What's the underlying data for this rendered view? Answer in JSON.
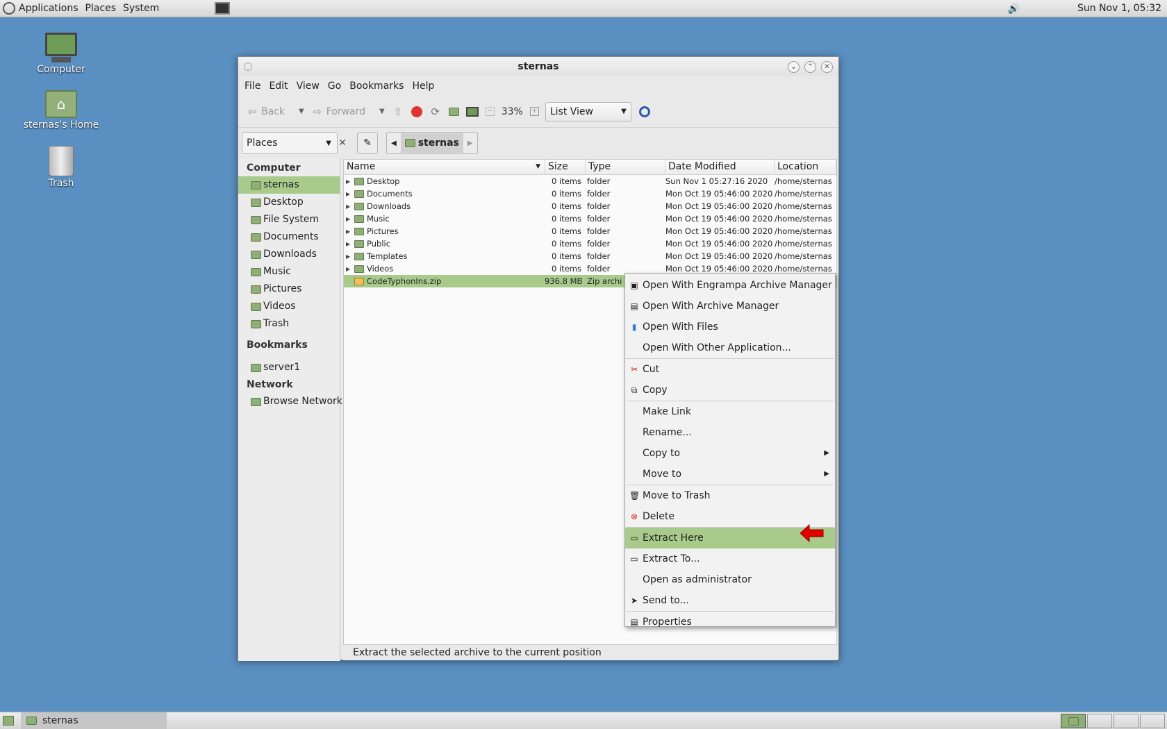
{
  "top_panel": {
    "applications": "Applications",
    "places": "Places",
    "system": "System",
    "clock": "Sun Nov  1, 05:32"
  },
  "desktop": {
    "icons": [
      {
        "label": "Computer"
      },
      {
        "label": "sternas's Home"
      },
      {
        "label": "Trash"
      }
    ]
  },
  "window": {
    "title": "sternas",
    "menu": [
      "File",
      "Edit",
      "View",
      "Go",
      "Bookmarks",
      "Help"
    ],
    "toolbar": {
      "back": "Back",
      "forward": "Forward",
      "zoom": "33%",
      "view_mode": "List View"
    },
    "location": {
      "places_label": "Places",
      "path": "sternas"
    },
    "sidebar": {
      "computer_header": "Computer",
      "computer_items": [
        "sternas",
        "Desktop",
        "File System",
        "Documents",
        "Downloads",
        "Music",
        "Pictures",
        "Videos",
        "Trash"
      ],
      "bookmarks_header": "Bookmarks",
      "bookmark_items": [
        "server1"
      ],
      "network_header": "Network",
      "network_items": [
        "Browse Network"
      ]
    },
    "columns": [
      "Name",
      "Size",
      "Type",
      "Date Modified",
      "Location"
    ],
    "files": [
      {
        "name": "Desktop",
        "size": "0 items",
        "type": "folder",
        "date": "Sun Nov  1 05:27:16 2020",
        "location": "/home/sternas"
      },
      {
        "name": "Documents",
        "size": "0 items",
        "type": "folder",
        "date": "Mon Oct 19 05:46:00 2020",
        "location": "/home/sternas"
      },
      {
        "name": "Downloads",
        "size": "0 items",
        "type": "folder",
        "date": "Mon Oct 19 05:46:00 2020",
        "location": "/home/sternas"
      },
      {
        "name": "Music",
        "size": "0 items",
        "type": "folder",
        "date": "Mon Oct 19 05:46:00 2020",
        "location": "/home/sternas"
      },
      {
        "name": "Pictures",
        "size": "0 items",
        "type": "folder",
        "date": "Mon Oct 19 05:46:00 2020",
        "location": "/home/sternas"
      },
      {
        "name": "Public",
        "size": "0 items",
        "type": "folder",
        "date": "Mon Oct 19 05:46:00 2020",
        "location": "/home/sternas"
      },
      {
        "name": "Templates",
        "size": "0 items",
        "type": "folder",
        "date": "Mon Oct 19 05:46:00 2020",
        "location": "/home/sternas"
      },
      {
        "name": "Videos",
        "size": "0 items",
        "type": "folder",
        "date": "Mon Oct 19 05:46:00 2020",
        "location": "/home/sternas"
      },
      {
        "name": "CodeTyphonIns.zip",
        "size": "936.8 MB",
        "type": "Zip archi",
        "date": "",
        "location": ""
      }
    ],
    "status": "Extract the selected archive to the current position"
  },
  "context_menu": {
    "items": [
      "Open With Engrampa Archive Manager",
      "Open With Archive Manager",
      "Open With Files",
      "Open With Other Application...",
      "Cut",
      "Copy",
      "Make Link",
      "Rename...",
      "Copy to",
      "Move to",
      "Move to Trash",
      "Delete",
      "Extract Here",
      "Extract To...",
      "Open as administrator",
      "Send to...",
      "Properties"
    ]
  },
  "taskbar": {
    "task": "sternas"
  },
  "colors": {
    "desktop": "#5a8fc1",
    "selection": "#a8cb8c",
    "arrow": "#e00000"
  }
}
